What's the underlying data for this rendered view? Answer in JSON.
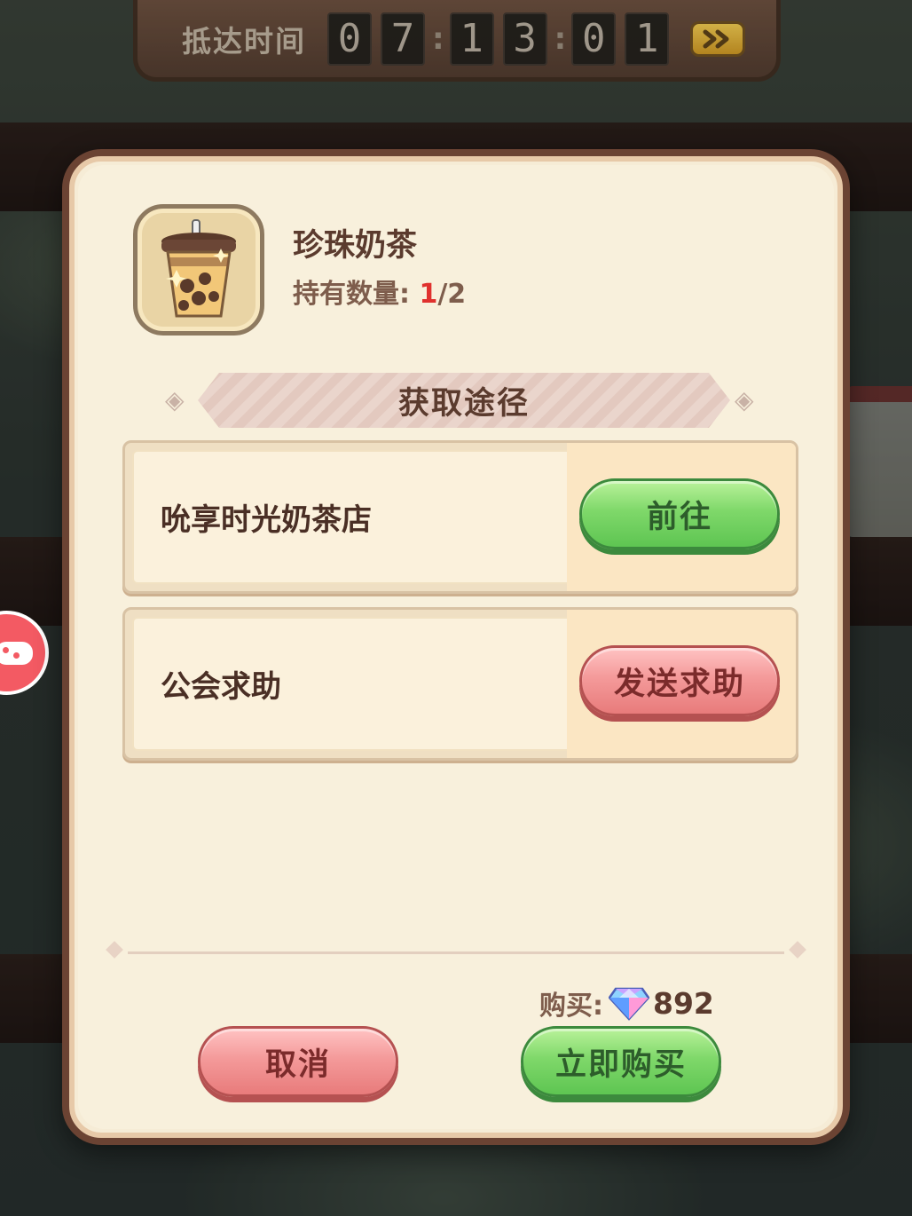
{
  "timer": {
    "label": "抵达时间",
    "digits": [
      "0",
      "7",
      "1",
      "3",
      "0",
      "1"
    ]
  },
  "item": {
    "name": "珍珠奶茶",
    "count_label": "持有数量:",
    "count_have": "1",
    "count_total": "/2"
  },
  "section": {
    "title": "获取途径"
  },
  "sources": [
    {
      "name": "吮享时光奶茶店",
      "button": "前往"
    },
    {
      "name": "公会求助",
      "button": "发送求助"
    }
  ],
  "purchase": {
    "label": "购买:",
    "price": "892",
    "cancel_label": "取消",
    "buy_label": "立即购买"
  },
  "colors": {
    "green_button": "#7fd86a",
    "red_button": "#f49a9a",
    "count_red": "#e0312e",
    "dialog_frame": "#6b4333"
  }
}
